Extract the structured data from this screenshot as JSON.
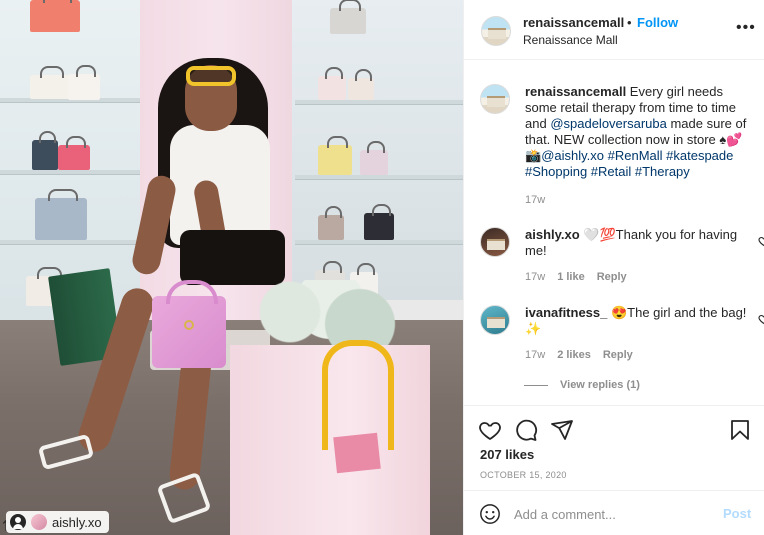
{
  "photo": {
    "tagged_user": "aishly.xo",
    "icons": {
      "repost": "repost-icon",
      "tag": "user-tag-icon"
    }
  },
  "header": {
    "username": "renaissancemall",
    "separator": "•",
    "follow_label": "Follow",
    "location": "Renaissance Mall",
    "more_icon": "more-options-icon"
  },
  "caption": {
    "username": "renaissancemall",
    "text_1": " Every girl needs some retail therapy from time to time and ",
    "mention_1": "@spadeloversaruba",
    "text_2": " made sure of that. NEW collection now in store ♠💕 📸",
    "mention_2": "@aishly.xo",
    "tags": "#RenMall #katespade #Shopping #Retail #Therapy",
    "age": "17w"
  },
  "comments": [
    {
      "username": "aishly.xo",
      "text": " 🤍💯Thank you for having me!",
      "age": "17w",
      "likes": "1 like",
      "reply": "Reply"
    },
    {
      "username": "ivanafitness_",
      "text": " 😍The girl and the bag!✨",
      "age": "17w",
      "likes": "2 likes",
      "reply": "Reply",
      "view_replies": "View replies (1)"
    }
  ],
  "actions": {
    "likes": "207 likes",
    "date": "OCTOBER 15, 2020",
    "icons": [
      "heart-icon",
      "comment-icon",
      "share-icon",
      "bookmark-icon"
    ]
  },
  "composer": {
    "placeholder": "Add a comment...",
    "post_label": "Post",
    "emoji_icon": "emoji-icon"
  },
  "colors": {
    "link": "#00376b",
    "follow": "#0095f6",
    "post_disabled": "#b3dbff",
    "muted": "#8e8e8e"
  }
}
